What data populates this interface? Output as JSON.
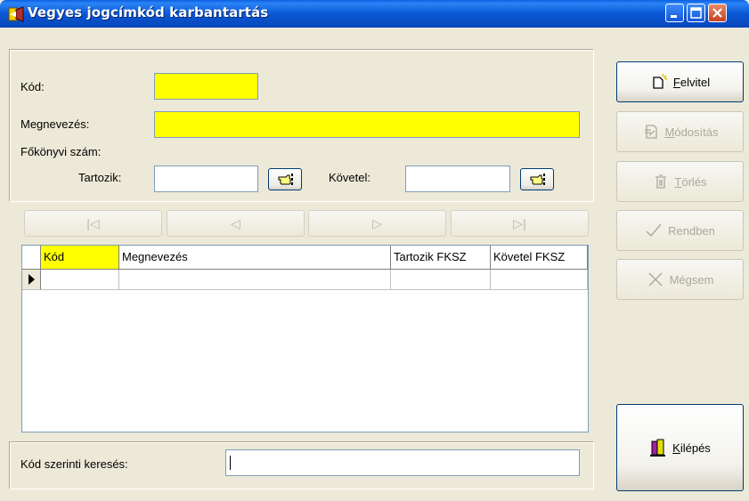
{
  "window": {
    "title": "Vegyes jogcímkód karbantartás",
    "colors": {
      "titlebar": "#0A57D6",
      "required_field": "#FFFF00"
    }
  },
  "form": {
    "kod_label": "Kód:",
    "kod_value": "",
    "megnevezes_label": "Megnevezés:",
    "megnevezes_value": "",
    "fokonyvi_label": "Főkönyvi szám:",
    "tartozik_label": "Tartozik:",
    "tartozik_value": "",
    "kovetel_label": "Követel:",
    "kovetel_value": ""
  },
  "navigator": {
    "first": "|◁",
    "prev": "◁",
    "next": "▷",
    "last": "▷|"
  },
  "grid": {
    "columns": [
      "Kód",
      "Megnevezés",
      "Tartozik FKSZ",
      "Követel FKSZ"
    ],
    "rows": [
      [
        "",
        "",
        "",
        ""
      ]
    ]
  },
  "search": {
    "label": "Kód szerinti keresés:",
    "value": ""
  },
  "buttons": {
    "felvitel": {
      "hotkey": "F",
      "rest": "elvitel",
      "icon": "new-document-icon",
      "enabled": true
    },
    "modositas": {
      "hotkey": "M",
      "rest": "ódosítás",
      "icon": "edit-document-icon",
      "enabled": false
    },
    "torles": {
      "hotkey": "T",
      "rest": "örlés",
      "icon": "trash-icon",
      "enabled": false
    },
    "rendben": {
      "label": "Rendben",
      "icon": "checkmark-icon",
      "enabled": false
    },
    "megsem": {
      "label": "Mégsem",
      "icon": "x-icon",
      "enabled": false
    },
    "kilepes": {
      "hotkey": "K",
      "rest": "ilépés",
      "icon": "exit-door-icon",
      "enabled": true
    }
  }
}
